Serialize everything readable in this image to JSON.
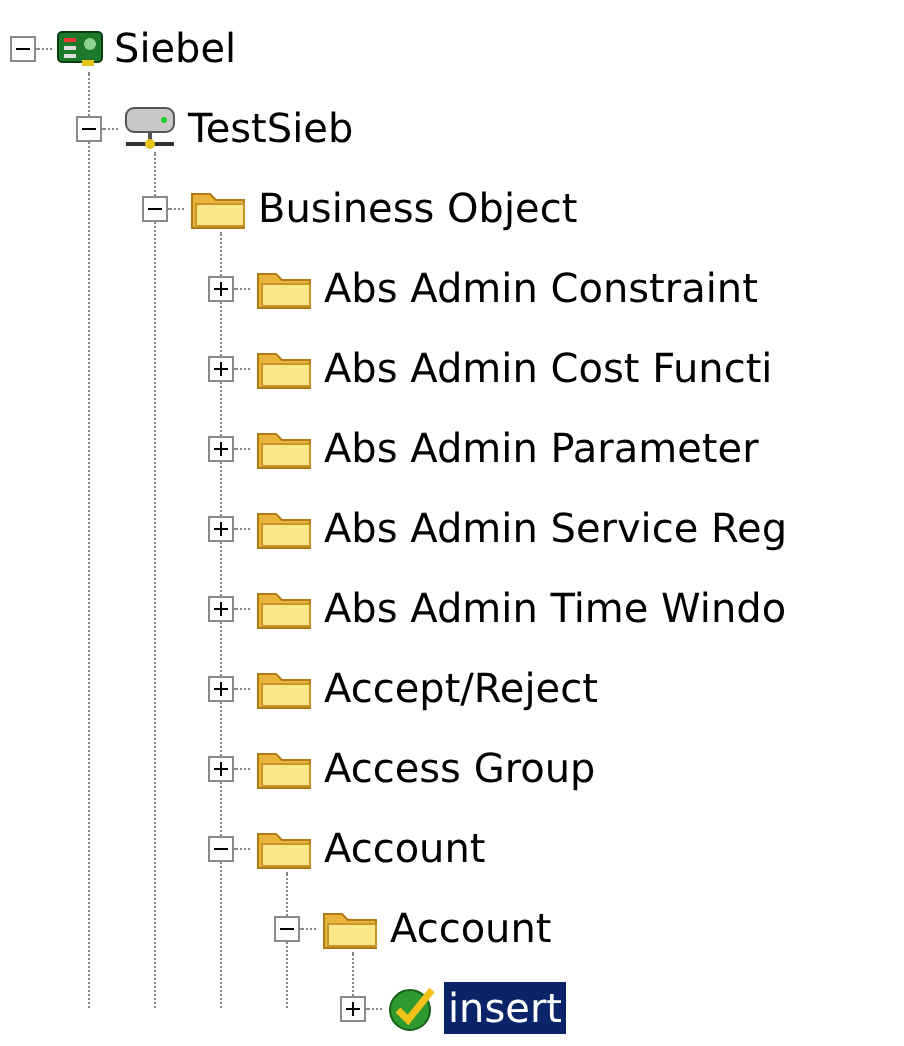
{
  "tree": [
    {
      "label": "Siebel",
      "kind": "app",
      "expanded": true,
      "selected": false,
      "children": [
        {
          "label": "TestSieb",
          "kind": "server",
          "expanded": true,
          "selected": false,
          "children": [
            {
              "label": "Business Object",
              "kind": "folder",
              "expanded": true,
              "selected": false,
              "children": [
                {
                  "label": "Abs Admin Constraint",
                  "kind": "folder",
                  "expanded": false,
                  "selected": false
                },
                {
                  "label": "Abs Admin Cost Functi",
                  "kind": "folder",
                  "expanded": false,
                  "selected": false
                },
                {
                  "label": "Abs Admin Parameter",
                  "kind": "folder",
                  "expanded": false,
                  "selected": false
                },
                {
                  "label": "Abs Admin Service Reg",
                  "kind": "folder",
                  "expanded": false,
                  "selected": false
                },
                {
                  "label": "Abs Admin Time Windo",
                  "kind": "folder",
                  "expanded": false,
                  "selected": false
                },
                {
                  "label": "Accept/Reject",
                  "kind": "folder",
                  "expanded": false,
                  "selected": false
                },
                {
                  "label": "Access Group",
                  "kind": "folder",
                  "expanded": false,
                  "selected": false
                },
                {
                  "label": "Account",
                  "kind": "folder",
                  "expanded": true,
                  "selected": false,
                  "children": [
                    {
                      "label": "Account",
                      "kind": "folder",
                      "expanded": true,
                      "selected": false,
                      "children": [
                        {
                          "label": "insert",
                          "kind": "check",
                          "expanded": false,
                          "selected": true
                        }
                      ]
                    }
                  ]
                }
              ]
            }
          ]
        }
      ]
    }
  ]
}
